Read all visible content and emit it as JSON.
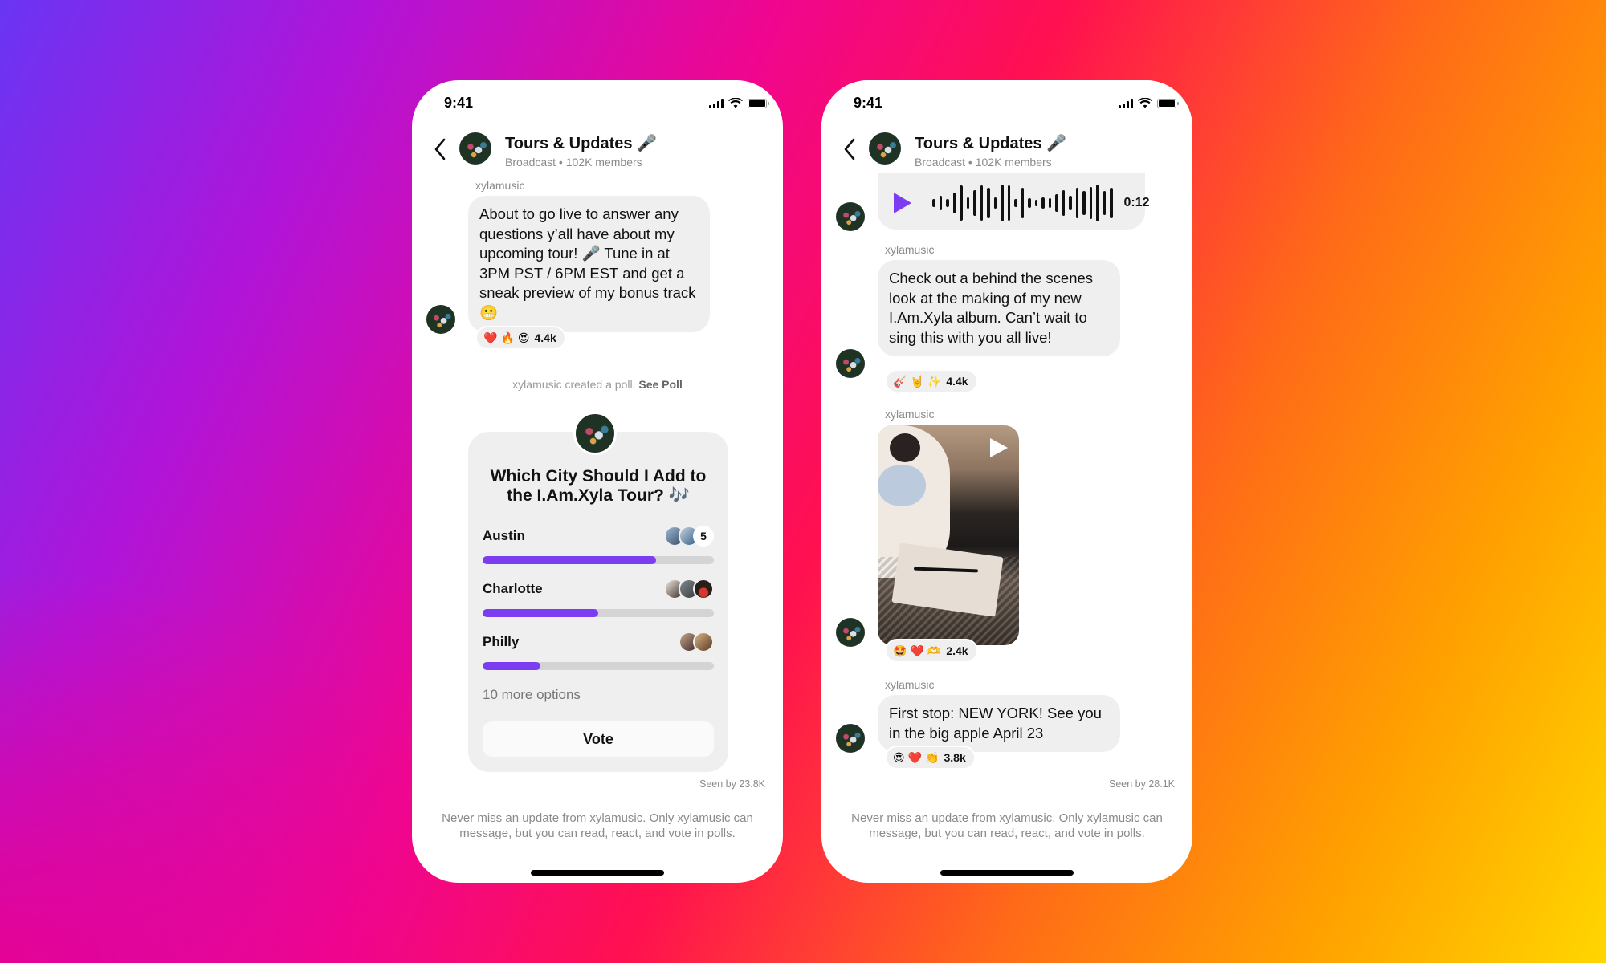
{
  "colors": {
    "accent": "#7c3cf0",
    "bubble": "#efefef",
    "bg_gradient": [
      "#6a35f4",
      "#b014d8",
      "#f0068f",
      "#ff1050",
      "#ff6a18",
      "#ffa000",
      "#ffd600"
    ]
  },
  "phones": [
    {
      "status": {
        "time": "9:41",
        "icons": [
          "signal-icon",
          "wifi-icon",
          "battery-icon"
        ]
      },
      "header": {
        "back_icon": "chevron-left-icon",
        "title": "Tours & Updates 🎤",
        "subtitle": "Broadcast • 102K members"
      },
      "messages": [
        {
          "sender": "xylamusic",
          "text": "About to go live to answer any questions y’all have about my upcoming tour! 🎤 Tune in at 3PM PST / 6PM EST and get a sneak preview of my bonus track 😬",
          "reactions": {
            "emojis": [
              "❤️",
              "🔥",
              "😍"
            ],
            "count": "4.4k"
          }
        }
      ],
      "system_note": {
        "text": "xylamusic created a poll. ",
        "link": "See Poll"
      },
      "poll": {
        "title": "Which City Should I Add to the I.Am.Xyla Tour? 🎶",
        "options": [
          {
            "label": "Austin",
            "fraction": 0.75,
            "voters_extra_count": "5"
          },
          {
            "label": "Charlotte",
            "fraction": 0.5
          },
          {
            "label": "Philly",
            "fraction": 0.25
          }
        ],
        "more_options": "10 more options",
        "vote_label": "Vote"
      },
      "seen": "Seen by 23.8K",
      "footer": "Never miss an update from xylamusic. Only xylamusic can message, but you can read, react, and vote in polls."
    },
    {
      "status": {
        "time": "9:41",
        "icons": [
          "signal-icon",
          "wifi-icon",
          "battery-icon"
        ]
      },
      "header": {
        "back_icon": "chevron-left-icon",
        "title": "Tours & Updates 🎤",
        "subtitle": "Broadcast • 102K members"
      },
      "voice": {
        "duration": "0:12"
      },
      "messages": [
        {
          "sender": "xylamusic",
          "text": "Check out a behind the scenes look at the making of my new I.Am.Xyla album. Can’t wait to sing this with you all live!",
          "reactions": {
            "emojis": [
              "🎸",
              "🤘",
              "✨"
            ],
            "count": "4.4k"
          }
        },
        {
          "sender": "xylamusic",
          "type": "video",
          "reactions": {
            "emojis": [
              "🤩",
              "❤️",
              "🫶"
            ],
            "count": "2.4k"
          }
        },
        {
          "sender": "xylamusic",
          "text": "First stop: NEW YORK! See you in the big apple April 23",
          "reactions": {
            "emojis": [
              "😍",
              "❤️",
              "👏"
            ],
            "count": "3.8k"
          }
        }
      ],
      "seen": "Seen by 28.1K",
      "footer": "Never miss an update from xylamusic. Only xylamusic can message, but you can read, react, and vote in polls."
    }
  ]
}
